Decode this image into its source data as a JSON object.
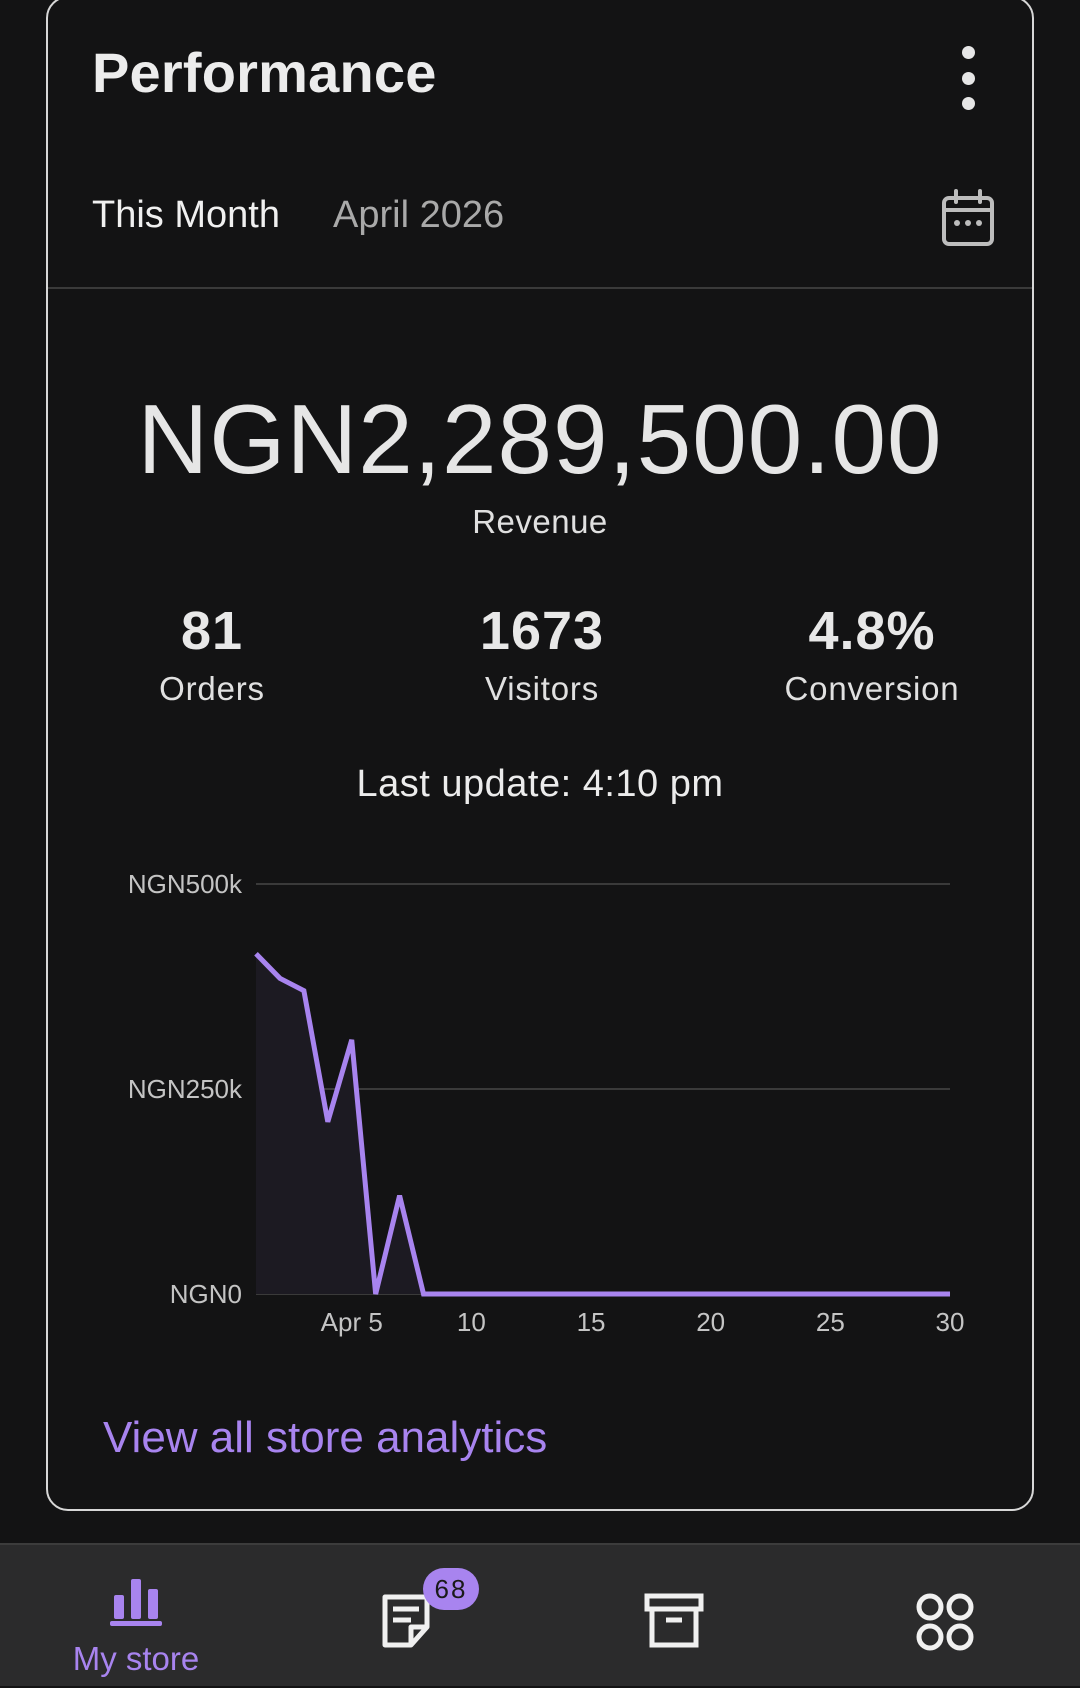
{
  "card": {
    "title": "Performance",
    "more_icon": "more-vert-icon",
    "period_label": "This Month",
    "period_value": "April 2026",
    "calendar_icon": "calendar-icon"
  },
  "revenue": {
    "amount": "NGN2,289,500.00",
    "label": "Revenue"
  },
  "stats": [
    {
      "value": "81",
      "label": "Orders"
    },
    {
      "value": "1673",
      "label": "Visitors"
    },
    {
      "value": "4.8%",
      "label": "Conversion"
    }
  ],
  "last_update": "Last update: 4:10 pm",
  "chart_data": {
    "type": "area",
    "title": "",
    "xlabel": "",
    "ylabel": "",
    "x": [
      1,
      2,
      3,
      4,
      5,
      6,
      7,
      8,
      9,
      10,
      11,
      12,
      13,
      14,
      15,
      16,
      17,
      18,
      19,
      20,
      21,
      22,
      23,
      24,
      25,
      26,
      27,
      28,
      29,
      30
    ],
    "values": [
      415000,
      385000,
      370000,
      210000,
      310000,
      0,
      120000,
      0,
      0,
      0,
      0,
      0,
      0,
      0,
      0,
      0,
      0,
      0,
      0,
      0,
      0,
      0,
      0,
      0,
      0,
      0,
      0,
      0,
      0,
      0
    ],
    "xlim": [
      1,
      30
    ],
    "ylim": [
      0,
      500000
    ],
    "x_ticks": [
      {
        "value": 5,
        "label": "Apr 5"
      },
      {
        "value": 10,
        "label": "10"
      },
      {
        "value": 15,
        "label": "15"
      },
      {
        "value": 20,
        "label": "20"
      },
      {
        "value": 25,
        "label": "25"
      },
      {
        "value": 30,
        "label": "30"
      }
    ],
    "y_ticks": [
      {
        "value": 500000,
        "label": "NGN500k"
      },
      {
        "value": 250000,
        "label": "NGN250k"
      },
      {
        "value": 0,
        "label": "NGN0"
      }
    ],
    "grid": true,
    "legend": "none",
    "line_color": "#a884ef",
    "fill_color": "#1c1a22",
    "grid_color": "#3a3a3a"
  },
  "analytics_link": "View all store analytics",
  "bottom_nav": {
    "items": [
      {
        "label": "My store",
        "icon": "bar-chart-icon",
        "active": true
      },
      {
        "label": "",
        "icon": "orders-icon",
        "badge": "68"
      },
      {
        "label": "",
        "icon": "archive-icon"
      },
      {
        "label": "",
        "icon": "menu-grid-icon"
      }
    ],
    "accent": "#a884ef"
  }
}
